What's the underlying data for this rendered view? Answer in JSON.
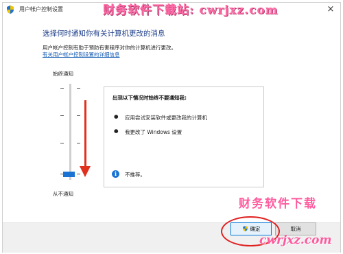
{
  "window": {
    "title": "用户帐户控制设置",
    "close_glyph": "×",
    "icon": "uac-shield-icon"
  },
  "watermarks": {
    "top": "财务软件下载站: cwrjxz.com",
    "bottom_line1": "财务软件下载",
    "bottom_line2": "cwrjxz.com"
  },
  "main": {
    "heading": "选择何时通知你有关计算机更改的消息",
    "description": "用户帐户控制有助于预防有害程序对你的计算机进行更改。",
    "link": "有关用户帐户控制设置的详细信息"
  },
  "slider": {
    "top_label": "始终通知",
    "bottom_label": "从不通知",
    "levels": 4,
    "selected_level": 1,
    "selected_level_description": "lowest (never notify)"
  },
  "info_box": {
    "title": "出现以下情况时始终不要通知我:",
    "bullets": [
      "应用尝试安装软件或更改我的计算机",
      "我更改了 Windows 设置"
    ],
    "note": "不推荐。",
    "note_icon": "info-icon"
  },
  "footer": {
    "ok_label": "确定",
    "cancel_label": "取消"
  },
  "colors": {
    "heading": "#1e3f8a",
    "link": "#1a5fb4",
    "slider_thumb": "#1b74d4",
    "annotation_red": "#e0301e",
    "watermark_pink": "#ff5a9e"
  }
}
